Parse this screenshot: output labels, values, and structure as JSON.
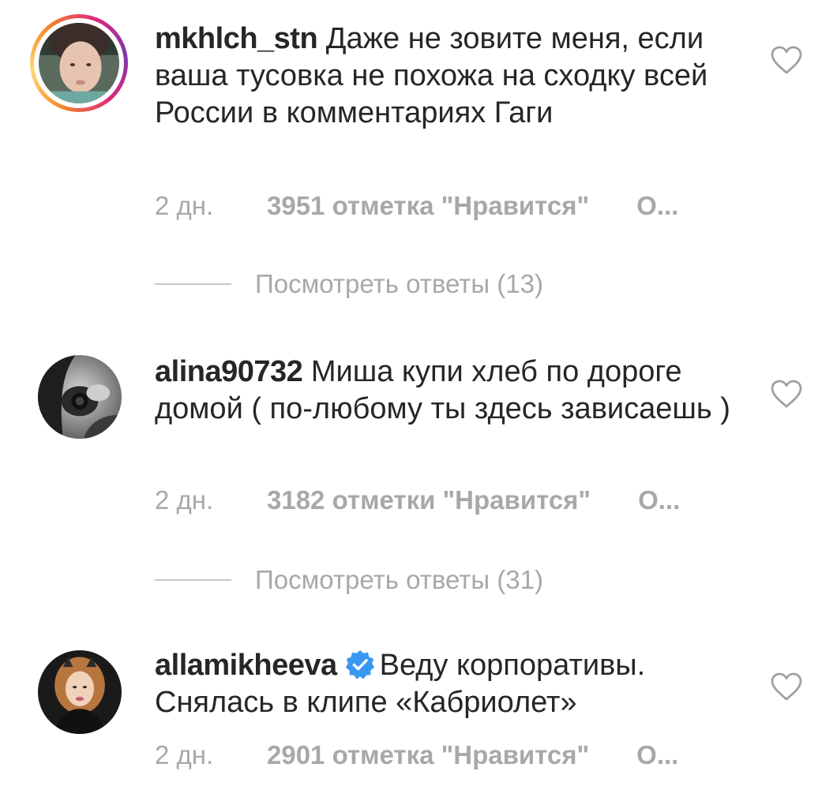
{
  "comments": [
    {
      "username": "mkhlch_stn",
      "text": "Даже не зовите меня, если ваша тусовка не похожа на сходку всей России в комментариях Гаги",
      "time": "2 дн.",
      "likes": "3951 отметка \"Нравится\"",
      "reply": "О...",
      "has_story_ring": true,
      "verified": false,
      "view_replies": "Посмотреть ответы (13)"
    },
    {
      "username": "alina90732",
      "text": "Миша купи хлеб по дороге домой ( по-любому ты здесь зависаешь )",
      "time": "2 дн.",
      "likes": "3182 отметки \"Нравится\"",
      "reply": "О...",
      "has_story_ring": false,
      "verified": false,
      "view_replies": "Посмотреть ответы (31)"
    },
    {
      "username": "allamikheeva",
      "text": "Веду корпоративы. Снялась в клипе «Кабриолет»",
      "time": "2 дн.",
      "likes": "2901 отметка \"Нравится\"",
      "reply": "О...",
      "has_story_ring": false,
      "verified": true
    }
  ],
  "icons": {
    "like": "heart-outline-icon",
    "verified": "verified-badge-icon"
  },
  "colors": {
    "text": "#262626",
    "muted": "#a8a8a8",
    "verified": "#3897f0"
  }
}
